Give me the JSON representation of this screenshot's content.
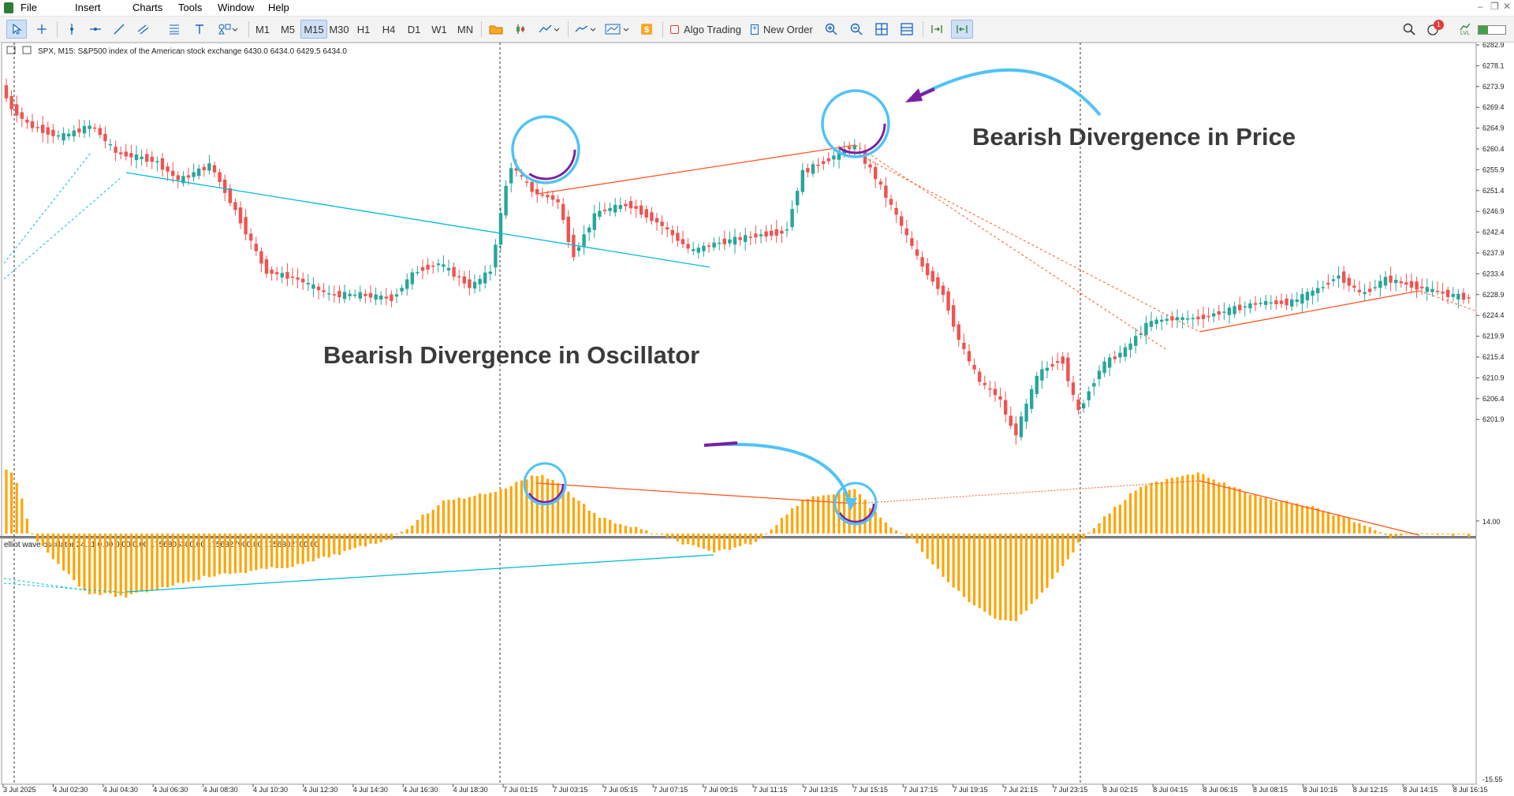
{
  "menu": [
    "File",
    "Insert",
    "Charts",
    "Tools",
    "Window",
    "Help"
  ],
  "toolbar": {
    "timeframes": [
      "M1",
      "M5",
      "M15",
      "M30",
      "H1",
      "H4",
      "D1",
      "W1",
      "MN"
    ],
    "active_timeframe": "M15",
    "algo_trading": "Algo Trading",
    "new_order": "New Order",
    "notification_count": "1",
    "signal_label": "LVL"
  },
  "chart": {
    "title": "SPX, M15:  S&P500 index of the American stock exchange  6430.0 6434.0 6429.5 6434.0",
    "price_axis": [
      "6282.9",
      "6278.1",
      "6273.9",
      "6269.4",
      "6264.9",
      "6260.4",
      "6255.9",
      "6251.4",
      "6246.9",
      "6242.4",
      "6237.9",
      "6233.4",
      "6228.9",
      "6224.4",
      "6219.9",
      "6215.4",
      "6210.9",
      "6206.4",
      "6201.9"
    ],
    "time_axis": [
      "3 Jul 2025",
      "4 Jul 02:30",
      "4 Jul 04:30",
      "4 Jul 06:30",
      "4 Jul 08:30",
      "4 Jul 10:30",
      "4 Jul 12:30",
      "4 Jul 14:30",
      "4 Jul 16:30",
      "4 Jul 18:30",
      "7 Jul 01:15",
      "7 Jul 03:15",
      "7 Jul 05:15",
      "7 Jul 07:15",
      "7 Jul 09:15",
      "7 Jul 11:15",
      "7 Jul 13:15",
      "7 Jul 15:15",
      "7 Jul 17:15",
      "7 Jul 19:15",
      "7 Jul 21:15",
      "7 Jul 23:15",
      "8 Jul 02:15",
      "8 Jul 04:15",
      "8 Jul 06:15",
      "8 Jul 08:15",
      "8 Jul 10:15",
      "8 Jul 12:15",
      "8 Jul 14:15",
      "8 Jul 16:15"
    ],
    "annotation_price": "Bearish Divergence in Price",
    "annotation_osc": "Bearish Divergence in Oscillator"
  },
  "oscillator": {
    "title": "elliot wave oscillator 24.11 0.00 0.00 0.00 1756806300.00 1756827900.00 1756802700.00",
    "axis_top": "14.00",
    "axis_bottom": "-15.55"
  },
  "colors": {
    "bull": "#26a69a",
    "bear": "#ef5350",
    "osc_bar": "#ffa500",
    "divergence_line": "#ff5722",
    "trend_line": "#00bcd4",
    "circle_outer": "#4fc3f7",
    "circle_inner": "#7b1fa2",
    "annotation_text": "#3a3a3a"
  }
}
